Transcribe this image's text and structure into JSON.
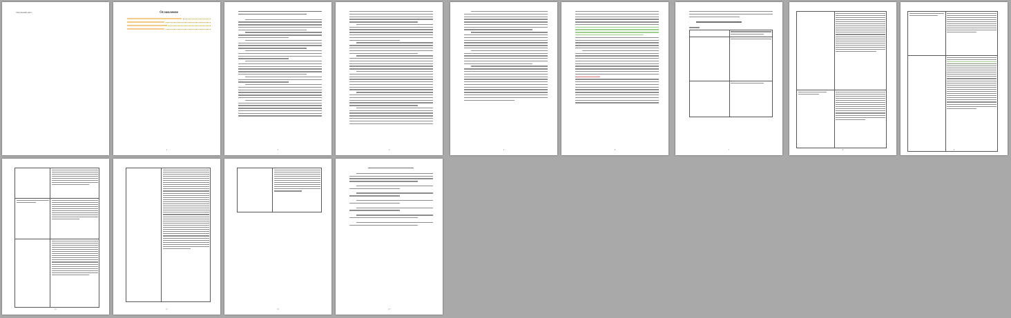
{
  "document": {
    "title_page_text": "Титульный лист",
    "toc_heading": "Оглавление",
    "toc_items": [
      "Теоретическая часть. Сопоставление конституционных форм правления в зарубежных государствах на примере трех государств",
      "Практическая часть. Заполнить таблицу",
      "Список использованных источников"
    ],
    "practical_heading": "Практическая часть. Заполнить таблицу",
    "practical_sub": "Ответ",
    "references_heading": "Список использованных источников",
    "page_numbers": [
      "2",
      "3",
      "4",
      "5",
      "6",
      "7",
      "8",
      "9",
      "10",
      "11",
      "12",
      "13",
      "14"
    ]
  },
  "colors": {
    "background": "#a9a9a9",
    "page": "#ffffff",
    "highlight_orange": "#f4c98a",
    "highlight_green": "#9ccf8a",
    "highlight_red": "#cf6b6b"
  }
}
